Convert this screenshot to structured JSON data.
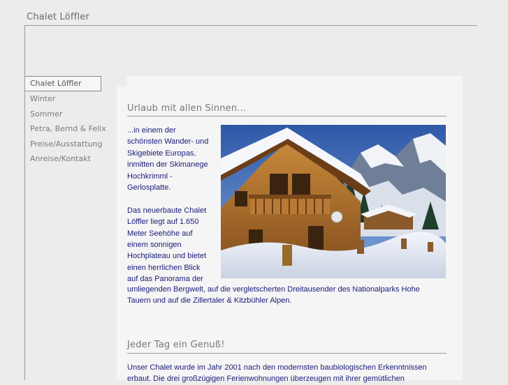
{
  "site": {
    "title": "Chalet Löffler"
  },
  "nav": {
    "items": [
      {
        "label": "Chalet Löffler"
      },
      {
        "label": "Winter"
      },
      {
        "label": "Sommer"
      },
      {
        "label": "Petra, Bernd & Felix"
      },
      {
        "label": "Preise/Ausstattung"
      },
      {
        "label": "Anreise/Kontakt"
      }
    ]
  },
  "section1": {
    "heading": "Urlaub mit allen Sinnen...",
    "para1_lines": [
      "...in einem der",
      "schönsten Wander- und",
      "Skigebiete Europas,",
      "inmitten der Skimanege",
      "Hochkrimml -",
      "Gerlosplatte."
    ],
    "para2_lines": [
      "Das neuerbaute Chalet",
      "Löffler liegt auf 1.650",
      "Meter Seehöhe auf",
      "einem sonnigen",
      "Hochplateau und bietet",
      "einen herrlichen Blick",
      "auf das Panorama der"
    ],
    "para2_full_lines": [
      "umliegenden Bergwelt, auf die vergletscherten Dreitausender des Nationalparks Hohe",
      "Tauern und auf die Zillertaler & Kitzbühler Alpen."
    ]
  },
  "section2": {
    "heading": "Jeder Tag ein Genuß!",
    "lines": [
      "Unser Chalet wurde im Jahr 2001 nach den modernsten baubiologischen Erkenntnissen",
      "erbaut. Die drei großzügigen Ferienwohnungen überzeugen mit ihrer gemütlichen"
    ]
  }
}
